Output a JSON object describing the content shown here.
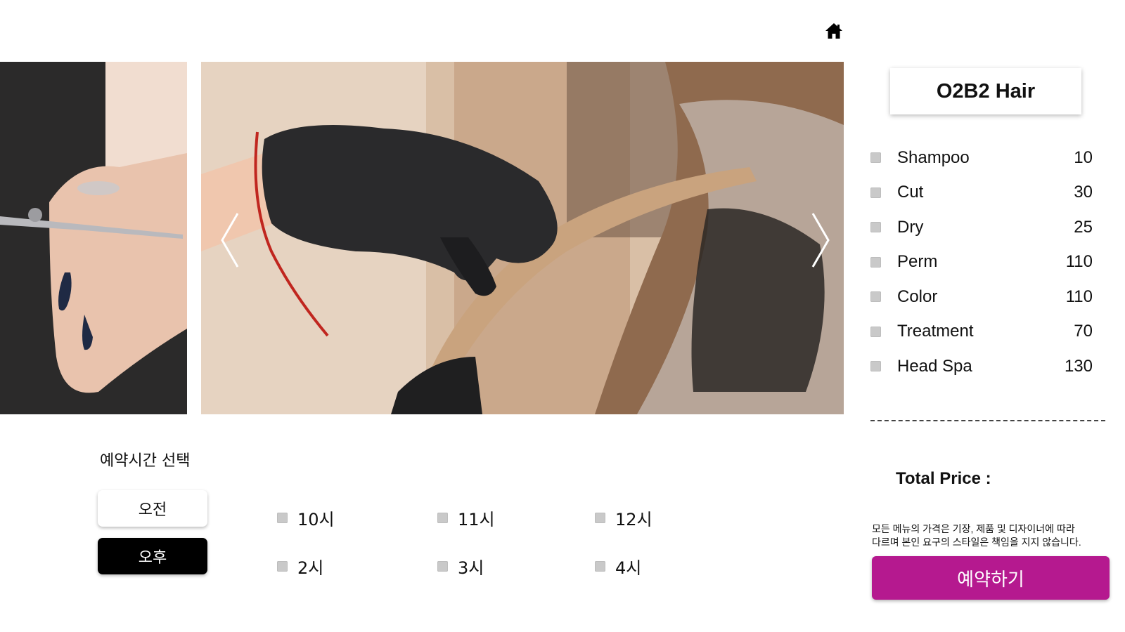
{
  "header": {
    "home_icon": "home-icon"
  },
  "carousel": {
    "prev_icon": "chevron-left-icon",
    "next_icon": "chevron-right-icon"
  },
  "shop": {
    "name": "O2B2 Hair"
  },
  "menu": {
    "items": [
      {
        "name": "Shampoo",
        "price": "10"
      },
      {
        "name": "Cut",
        "price": "30"
      },
      {
        "name": "Dry",
        "price": "25"
      },
      {
        "name": "Perm",
        "price": "110"
      },
      {
        "name": "Color",
        "price": "110"
      },
      {
        "name": "Treatment",
        "price": "70"
      },
      {
        "name": "Head Spa",
        "price": "130"
      }
    ]
  },
  "total": {
    "label": "Total Price :"
  },
  "notice": {
    "line1": "모든 메뉴의 가격은 기장, 제품 및 디자이너에 따라",
    "line2": "다르며 본인 요구의 스타일은 책임을 지지 않습니다."
  },
  "reserve": {
    "label": "예약하기",
    "color": "#b5198f"
  },
  "time_selection": {
    "title": "예약시간 선택",
    "am_label": "오전",
    "pm_label": "오후",
    "selected_period": "오후",
    "am_slots": [
      "10시",
      "11시",
      "12시"
    ],
    "pm_slots": [
      "2시",
      "3시",
      "4시"
    ]
  }
}
